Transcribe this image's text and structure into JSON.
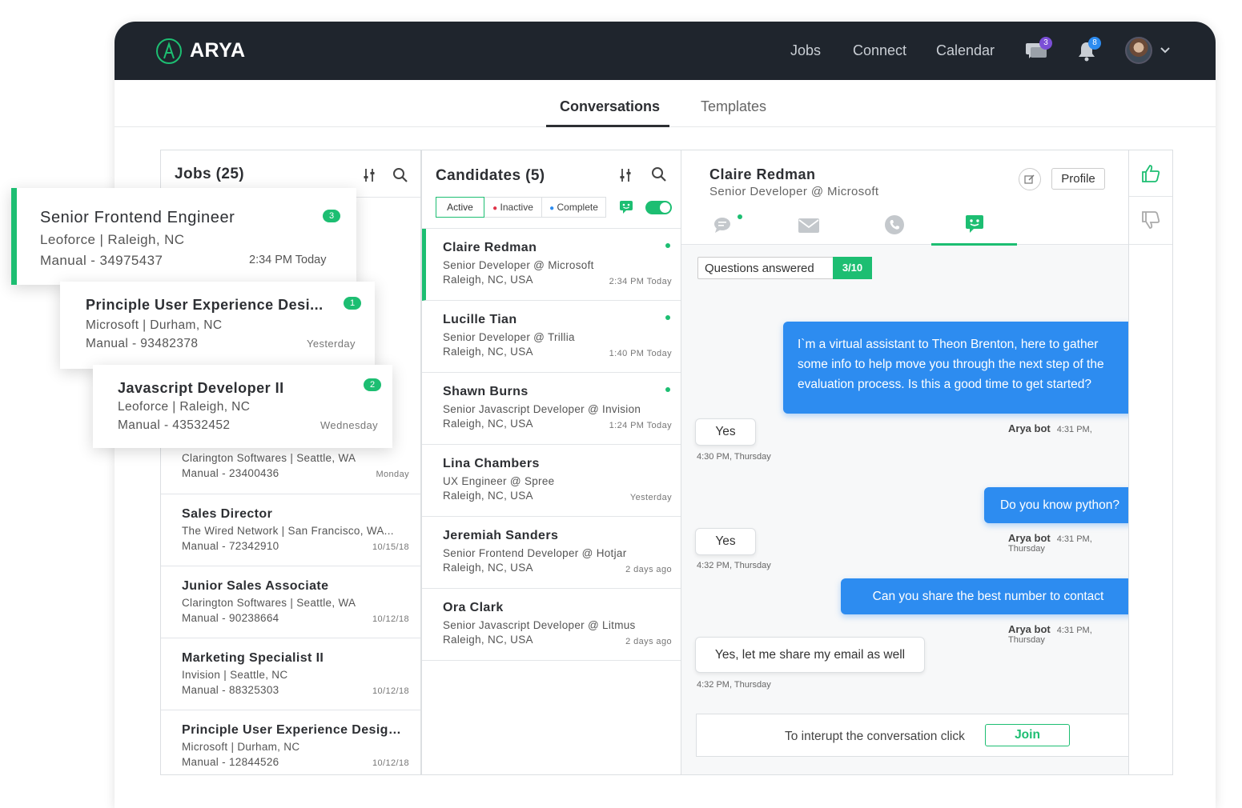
{
  "brand": {
    "name": "ARYA",
    "accent": "#1dbe72",
    "blue": "#2d8cf0",
    "navbar_bg": "#1f252d"
  },
  "nav": {
    "links": [
      "Jobs",
      "Connect",
      "Calendar"
    ],
    "messages_badge": "3",
    "notifications_badge": "8"
  },
  "subtabs": {
    "conversations": "Conversations",
    "templates": "Templates"
  },
  "jobs": {
    "title": "Jobs (25)",
    "featured": [
      {
        "title": "Senior Frontend Engineer",
        "company": "Leoforce | Raleigh, NC",
        "meta": "Manual - 34975437",
        "date": "2:34 PM Today",
        "count": "3"
      },
      {
        "title": "Principle User Experience Desi...",
        "company": "Microsoft | Durham, NC",
        "meta": "Manual - 93482378",
        "date": "Yesterday",
        "count": "1"
      },
      {
        "title": "Javascript Developer II",
        "company": "Leoforce | Raleigh, NC",
        "meta": "Manual - 43532452",
        "date": "Wednesday",
        "count": "2"
      }
    ],
    "list": [
      {
        "title": "",
        "company": "Clarington Softwares | Seattle, WA",
        "meta": "Manual - 23400436",
        "date": "Monday"
      },
      {
        "title": "Sales Director",
        "company": "The Wired Network | San Francisco, WA...",
        "meta": "Manual - 72342910",
        "date": "10/15/18"
      },
      {
        "title": "Junior Sales Associate",
        "company": "Clarington Softwares | Seattle, WA",
        "meta": "Manual - 90238664",
        "date": "10/12/18"
      },
      {
        "title": "Marketing Specialist II",
        "company": "Invision | Seattle, NC",
        "meta": "Manual - 88325303",
        "date": "10/12/18"
      },
      {
        "title": "Principle User Experience Designe...",
        "company": "Microsoft | Durham, NC",
        "meta": "Manual - 12844526",
        "date": "10/12/18"
      }
    ]
  },
  "candidates": {
    "title": "Candidates (5)",
    "filters": {
      "active": "Active",
      "inactive": "Inactive",
      "complete": "Complete"
    },
    "list": [
      {
        "name": "Claire Redman",
        "role": "Senior Developer @ Microsoft",
        "location": "Raleigh, NC, USA",
        "time": "2:34 PM Today"
      },
      {
        "name": "Lucille Tian",
        "role": "Senior Developer @ Trillia",
        "location": "Raleigh, NC, USA",
        "time": "1:40 PM Today"
      },
      {
        "name": "Shawn Burns",
        "role": "Senior Javascript Developer @ Invision",
        "location": "Raleigh, NC, USA",
        "time": "1:24 PM Today"
      },
      {
        "name": "Lina Chambers",
        "role": "UX Engineer @ Spree",
        "location": "Raleigh, NC, USA",
        "time": "Yesterday"
      },
      {
        "name": "Jeremiah Sanders",
        "role": "Senior Frontend Developer @ Hotjar",
        "location": "Raleigh, NC, USA",
        "time": "2 days ago"
      },
      {
        "name": "Ora Clark",
        "role": "Senior Javascript Developer @ Litmus",
        "location": "Raleigh, NC, USA",
        "time": "2 days ago"
      }
    ]
  },
  "conversation": {
    "name": "Claire Redman",
    "role": "Senior Developer @ Microsoft",
    "profile_button": "Profile",
    "questions_label": "Questions answered",
    "questions_value": "3/10",
    "messages": [
      {
        "text": "I`m a virtual assistant to Theon Brenton, here to gather some info to help move you through the next step of the evaluation process. Is this a good time to get started?",
        "sender": "Arya bot",
        "time": "4:31 PM,"
      },
      {
        "text": "Yes",
        "time": "4:30 PM, Thursday"
      },
      {
        "text": "Do you know python?",
        "sender": "Arya bot",
        "time": "4:31 PM, Thursday"
      },
      {
        "text": "Yes",
        "time": "4:32 PM, Thursday"
      },
      {
        "text": "Can you share the best number to contact",
        "sender": "Arya bot",
        "time": "4:31 PM, Thursday"
      },
      {
        "text": "Yes, let me share my email as well",
        "time": "4:32 PM, Thursday"
      }
    ],
    "interrupt_text": "To interupt the conversation click",
    "join_button": "Join"
  }
}
